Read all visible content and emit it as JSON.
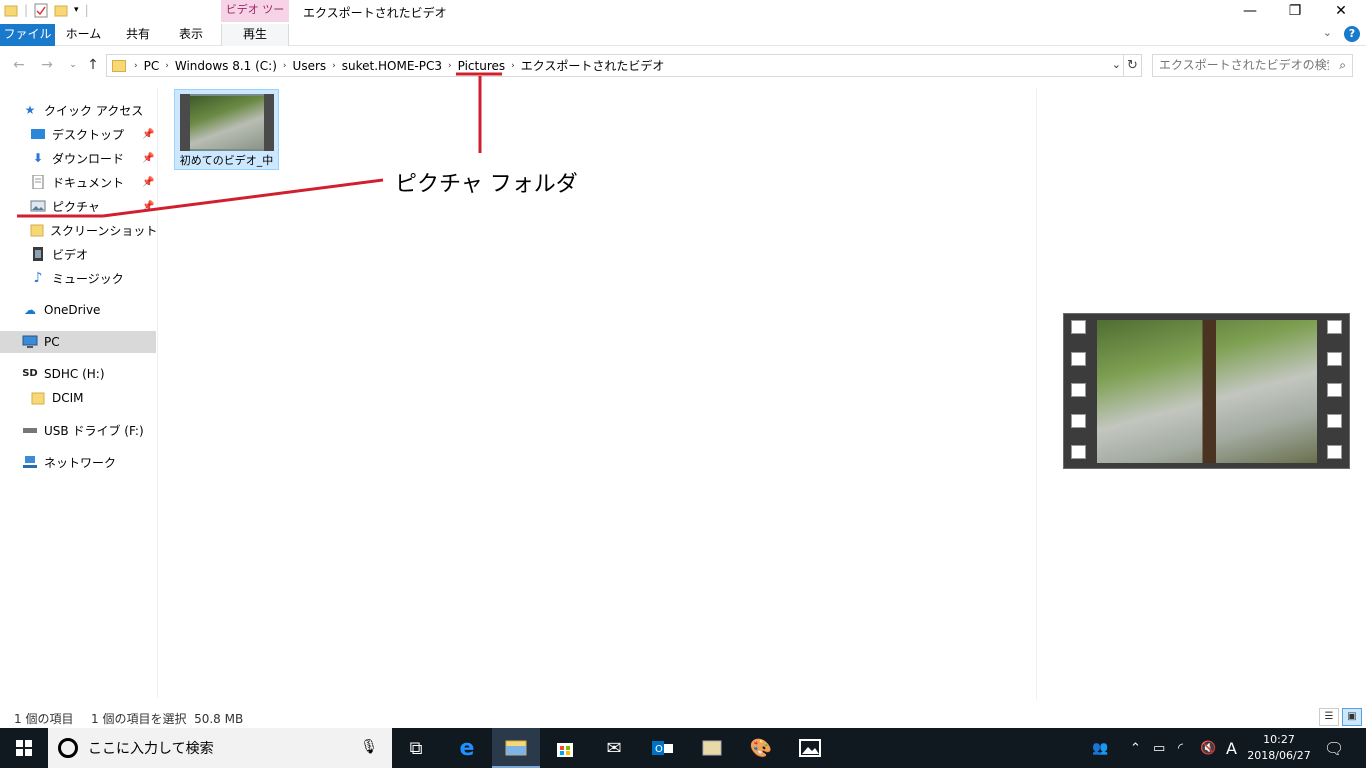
{
  "window": {
    "title": "エクスポートされたビデオ",
    "context_tab_group": "ビデオ ツール"
  },
  "ribbon": {
    "tabs": [
      {
        "label": "ファイル"
      },
      {
        "label": "ホーム"
      },
      {
        "label": "共有"
      },
      {
        "label": "表示"
      },
      {
        "label": "再生"
      }
    ]
  },
  "address": {
    "crumbs": [
      "PC",
      "Windows 8.1 (C:)",
      "Users",
      "suket.HOME-PC3",
      "Pictures",
      "エクスポートされたビデオ"
    ]
  },
  "search": {
    "placeholder": "エクスポートされたビデオの検索"
  },
  "nav": {
    "items": [
      {
        "label": "クイック アクセス",
        "icon": "star-icon"
      },
      {
        "label": "デスクトップ",
        "icon": "desktop-icon",
        "pinned": true
      },
      {
        "label": "ダウンロード",
        "icon": "download-icon",
        "pinned": true
      },
      {
        "label": "ドキュメント",
        "icon": "document-icon",
        "pinned": true
      },
      {
        "label": "ピクチャ",
        "icon": "pictures-icon",
        "pinned": true
      },
      {
        "label": "スクリーンショット",
        "icon": "folder-icon"
      },
      {
        "label": "ビデオ",
        "icon": "video-icon"
      },
      {
        "label": "ミュージック",
        "icon": "music-icon"
      },
      {
        "label": "OneDrive",
        "icon": "cloud-icon"
      },
      {
        "label": "PC",
        "icon": "pc-icon",
        "selected": true
      },
      {
        "label": "SDHC (H:)",
        "icon": "sd-card-icon"
      },
      {
        "label": "DCIM",
        "icon": "folder-icon"
      },
      {
        "label": "USB ドライブ (F:)",
        "icon": "usb-drive-icon"
      },
      {
        "label": "ネットワーク",
        "icon": "network-icon"
      }
    ]
  },
  "files": [
    {
      "name": "初めてのビデオ_中",
      "type": "video"
    }
  ],
  "annotation": {
    "text": "ピクチャ フォルダ",
    "color": "#d01f2f"
  },
  "status": {
    "count": "1 個の項目",
    "selection": "1 個の項目を選択  50.8 MB"
  },
  "taskbar": {
    "search_placeholder": "ここに入力して検索",
    "ime": "A",
    "time": "10:27",
    "date": "2018/06/27"
  },
  "colors": {
    "accent": "#1979ca",
    "selection": "#cce8ff",
    "taskbar": "#101820"
  }
}
